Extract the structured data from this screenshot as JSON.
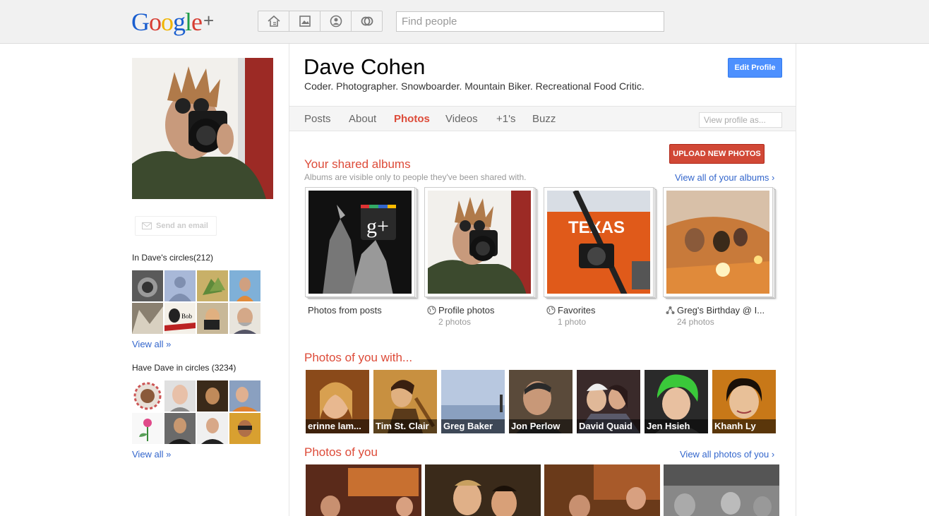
{
  "header": {
    "logo": {
      "g": "G",
      "o1": "o",
      "o2": "o",
      "g2": "g",
      "l": "l",
      "e": "e",
      "plus": "+"
    },
    "nav_icons": [
      "home-icon",
      "photos-icon",
      "profile-icon",
      "circles-icon"
    ],
    "search_placeholder": "Find people"
  },
  "sidebar": {
    "send_email": "Send an email",
    "in_circles_title": "In Dave's circles(212)",
    "have_in_circles_title": "Have Dave in circles (3234)",
    "view_all_1": "View all »",
    "view_all_2": "View all »"
  },
  "profile": {
    "name": "Dave Cohen",
    "tagline": "Coder. Photographer. Snowboarder. Mountain Biker. Recreational Food Critic.",
    "edit_button": "Edit Profile"
  },
  "tabs": {
    "posts": "Posts",
    "about": "About",
    "photos": "Photos",
    "videos": "Videos",
    "plusones": "+1's",
    "buzz": "Buzz",
    "view_as_placeholder": "View profile as..."
  },
  "shared_albums": {
    "title": "Your shared albums",
    "subtitle": "Albums are visible only to people they've been shared with.",
    "upload_button": "UPLOAD NEW PHOTOS",
    "view_all": "View all of your albums ›",
    "albums": [
      {
        "title": "Photos from posts",
        "count": "",
        "icon": ""
      },
      {
        "title": "Profile photos",
        "count": "2 photos",
        "icon": "globe-icon"
      },
      {
        "title": "Favorites",
        "count": "1 photo",
        "icon": "globe-icon"
      },
      {
        "title": "Greg's Birthday @ I...",
        "count": "24 photos",
        "icon": "shared-icon"
      }
    ]
  },
  "photos_with": {
    "title": "Photos of you with...",
    "people": [
      "erinne lam...",
      "Tim St. Clair",
      "Greg Baker",
      "Jon Perlow",
      "David Quaid",
      "Jen Hsieh",
      "Khanh Ly"
    ]
  },
  "photos_of_you": {
    "title": "Photos of you",
    "view_all": "View all photos of you ›"
  },
  "colors": {
    "accent_red": "#dd4b39",
    "link_blue": "#3366cc",
    "button_blue": "#4d90fe",
    "upload_red": "#d14836"
  }
}
